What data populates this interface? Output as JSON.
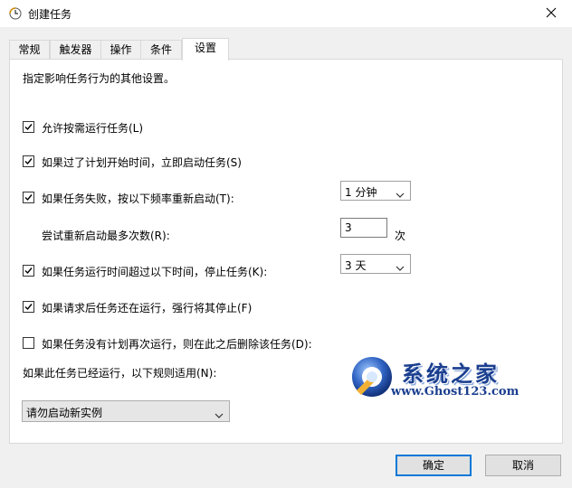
{
  "window": {
    "title": "创建任务",
    "close_symbol": "✕"
  },
  "tabs": [
    {
      "label": "常规"
    },
    {
      "label": "触发器"
    },
    {
      "label": "操作"
    },
    {
      "label": "条件"
    },
    {
      "label": "设置",
      "active": true
    }
  ],
  "settings": {
    "description": "指定影响任务行为的其他设置。",
    "allow_on_demand": {
      "label": "允许按需运行任务(L)",
      "checked": true
    },
    "run_if_missed": {
      "label": "如果过了计划开始时间，立即启动任务(S)",
      "checked": true
    },
    "restart_on_fail": {
      "label": "如果任务失败，按以下频率重新启动(T):",
      "checked": true,
      "interval": "1 分钟"
    },
    "restart_attempts": {
      "label": "尝试重新启动最多次数(R):",
      "value": "3",
      "unit": "次"
    },
    "stop_if_long": {
      "label": "如果任务运行时间超过以下时间，停止任务(K):",
      "checked": true,
      "duration": "3 天"
    },
    "force_stop": {
      "label": "如果请求后任务还在运行，强行将其停止(F)",
      "checked": true
    },
    "delete_if_unscheduled": {
      "label": "如果任务没有计划再次运行，则在此之后删除该任务(D):",
      "checked": false
    },
    "running_rule_label": "如果此任务已经运行，以下规则适用(N):",
    "running_rule_value": "请勿启动新实例"
  },
  "watermark": {
    "name": "系统之家",
    "url": "www.Ghost123.com"
  },
  "buttons": {
    "ok": "确定",
    "cancel": "取消"
  },
  "colors": {
    "accent": "#0078d7",
    "checkmark": "#000000",
    "watermark": "#1b3f8f"
  }
}
